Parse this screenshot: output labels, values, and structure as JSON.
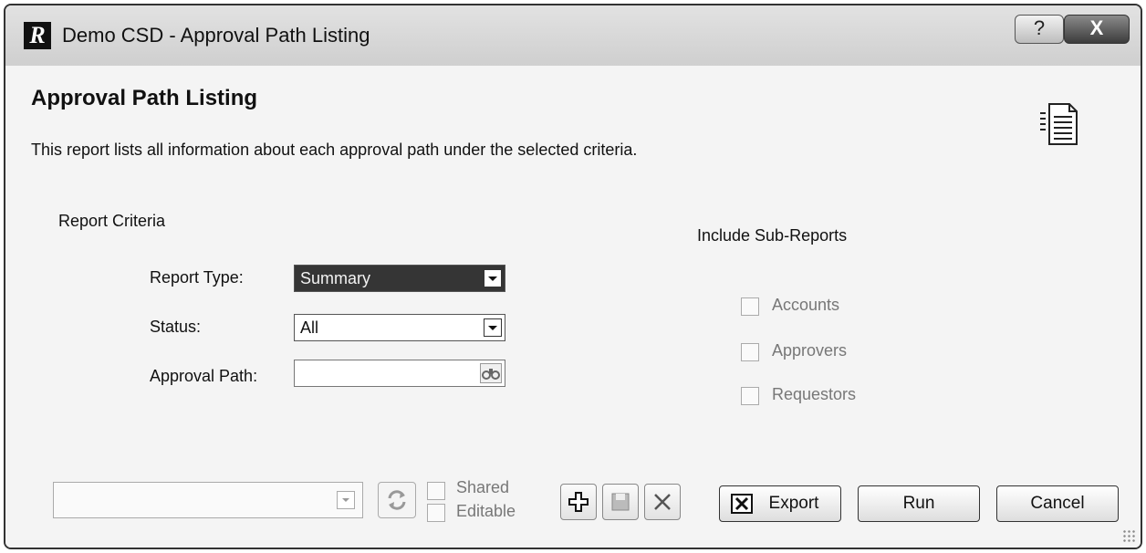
{
  "window": {
    "title": "Demo CSD - Approval Path Listing",
    "help_symbol": "?",
    "close_symbol": "X"
  },
  "page": {
    "title": "Approval Path Listing",
    "description": "This report lists all information about each approval path under the selected criteria.",
    "icon": "report-document-icon"
  },
  "criteria": {
    "section_label": "Report Criteria",
    "report_type": {
      "label": "Report Type:",
      "value": "Summary"
    },
    "status": {
      "label": "Status:",
      "value": "All"
    },
    "approval_path": {
      "label": "Approval Path:",
      "value": ""
    }
  },
  "sub_reports": {
    "title": "Include Sub-Reports",
    "items": [
      {
        "label": "Accounts",
        "checked": false
      },
      {
        "label": "Approvers",
        "checked": false
      },
      {
        "label": "Requestors",
        "checked": false
      }
    ]
  },
  "footer": {
    "saved_criteria_value": "",
    "shared_label": "Shared",
    "editable_label": "Editable",
    "export_label": "Export",
    "run_label": "Run",
    "cancel_label": "Cancel"
  }
}
